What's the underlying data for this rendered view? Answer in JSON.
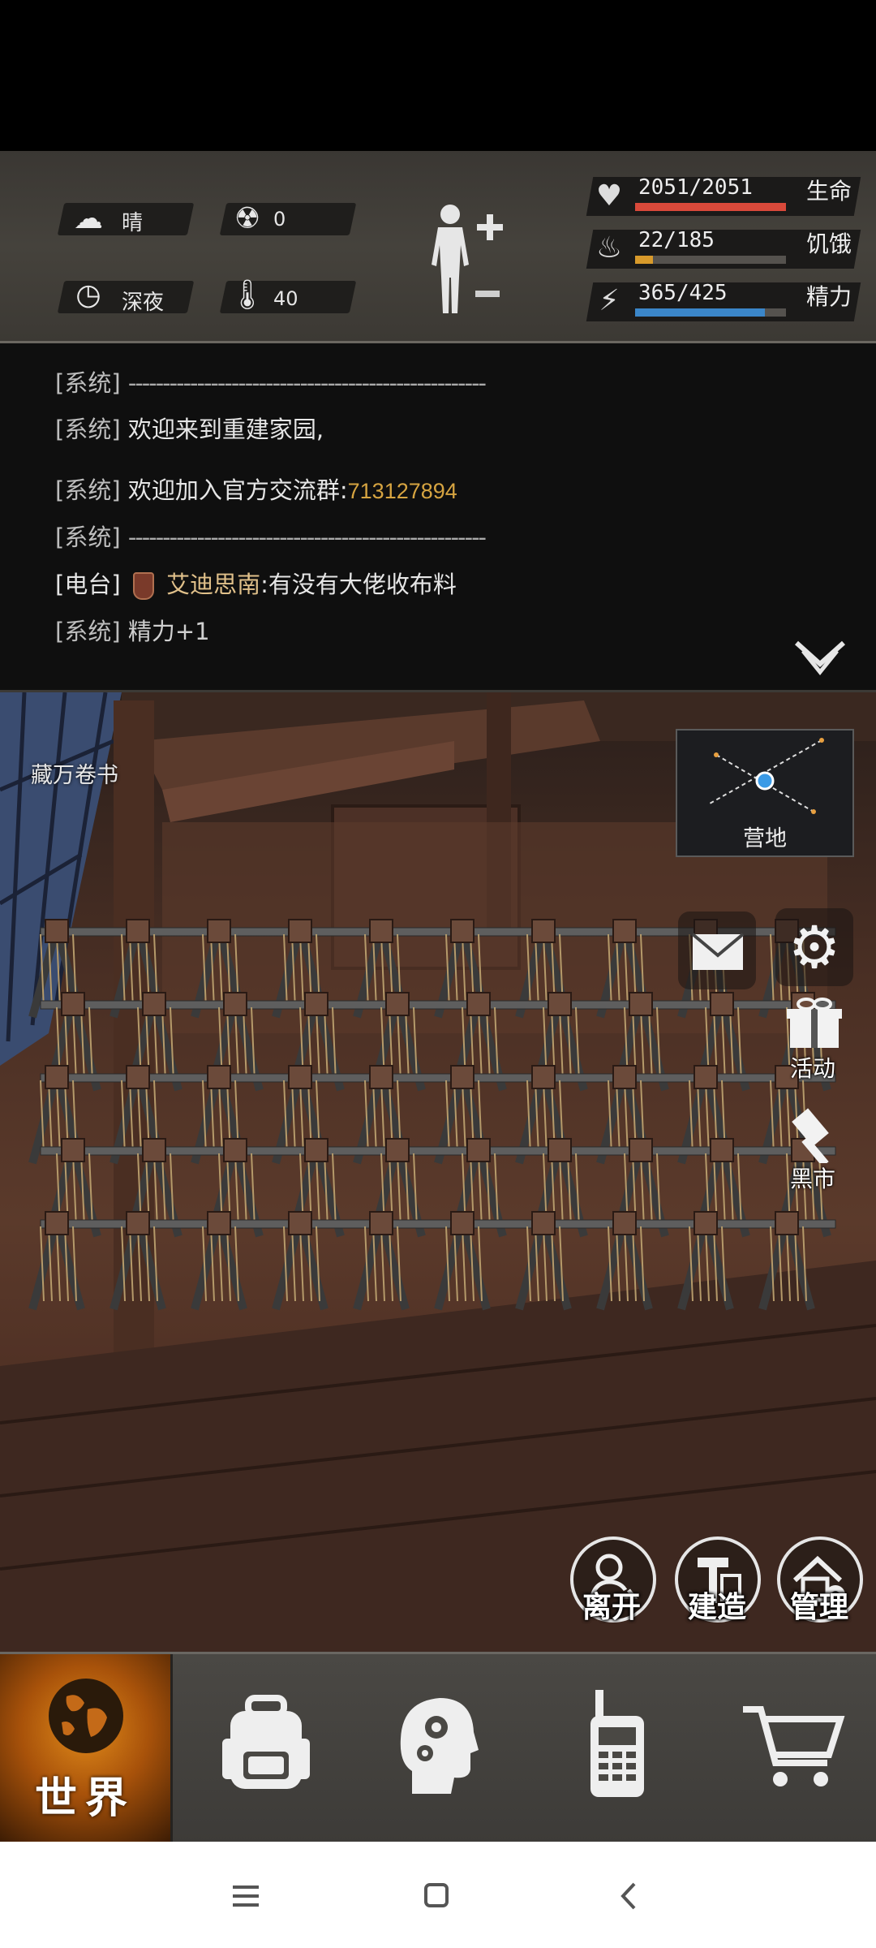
{
  "status": {
    "weather": "晴",
    "radiation": "0",
    "time_of_day": "深夜",
    "temperature": "40",
    "health": {
      "value": "2051/2051",
      "label": "生命",
      "fraction": 1.0,
      "color": "#d9493a"
    },
    "hunger": {
      "value": "22/185",
      "label": "饥饿",
      "fraction": 0.119,
      "color": "#d89a2b"
    },
    "energy": {
      "value": "365/425",
      "label": "精力",
      "fraction": 0.859,
      "color": "#3b86c9"
    }
  },
  "log": {
    "lines": [
      {
        "tag": "[系统]",
        "text": "----------------------------------------------------"
      },
      {
        "tag": "[系统]",
        "text": "欢迎来到重建家园,"
      },
      {
        "tag": "[系统]",
        "text": " 欢迎加入官方交流群:",
        "highlight": "713127894"
      },
      {
        "tag": "[系统]",
        "text": "----------------------------------------------------"
      },
      {
        "tag": "[电台]",
        "speaker": "艾迪思南",
        "text": ":有没有大佬收布料"
      },
      {
        "tag": "[系统]",
        "text": "精力+1"
      }
    ]
  },
  "scene": {
    "location": "藏万卷书",
    "minimap_label": "营地",
    "activity_label": "活动",
    "black_market_label": "黑市",
    "leave_label": "离开",
    "build_label": "建造",
    "manage_label": "管理"
  },
  "nav": {
    "world_label": "世界"
  },
  "colors": {
    "highlight": "#d6a441",
    "speaker": "#e0c08a"
  }
}
